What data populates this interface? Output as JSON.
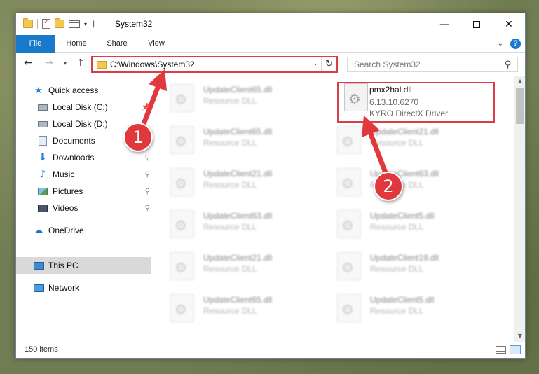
{
  "window": {
    "title": "System32",
    "controls": {
      "minimize": "—",
      "maximize": "",
      "close": "✕"
    }
  },
  "ribbon": {
    "tabs": [
      "File",
      "Home",
      "Share",
      "View"
    ],
    "help": "?"
  },
  "navigation": {
    "address": "C:\\Windows\\System32",
    "search_placeholder": "Search System32"
  },
  "sidebar": {
    "items": [
      {
        "label": "Quick access",
        "icon": "star-icon"
      },
      {
        "label": "Local Disk (C:)",
        "icon": "drive-icon"
      },
      {
        "label": "Local Disk (D:)",
        "icon": "drive-icon"
      },
      {
        "label": "Documents",
        "icon": "documents-icon"
      },
      {
        "label": "Downloads",
        "icon": "downloads-icon"
      },
      {
        "label": "Music",
        "icon": "music-icon"
      },
      {
        "label": "Pictures",
        "icon": "pictures-icon"
      },
      {
        "label": "Videos",
        "icon": "videos-icon"
      },
      {
        "label": "OneDrive",
        "icon": "cloud-icon"
      },
      {
        "label": "This PC",
        "icon": "computer-icon"
      },
      {
        "label": "Network",
        "icon": "network-icon"
      }
    ]
  },
  "files": {
    "left_column": [
      {
        "name": "UpdateClient65.dll",
        "desc": "Resource DLL"
      },
      {
        "name": "UpdateClient65.dll",
        "desc": "Resource DLL"
      },
      {
        "name": "UpdateClient21.dll",
        "desc": "Resource DLL"
      },
      {
        "name": "UpdateClient63.dll",
        "desc": "Resource DLL"
      },
      {
        "name": "UpdateClient21.dll",
        "desc": "Resource DLL"
      },
      {
        "name": "UpdateClient65.dll",
        "desc": "Resource DLL"
      }
    ],
    "right_column": [
      {
        "name": "UpdateClient21.dll",
        "desc": "Resource DLL"
      },
      {
        "name": "UpdateClient63.dll",
        "desc": "Resource DLL"
      },
      {
        "name": "UpdateClient5.dll",
        "desc": "Resource DLL"
      },
      {
        "name": "UpdateClient19.dll",
        "desc": "Resource DLL"
      },
      {
        "name": "UpdateClient5.dll",
        "desc": "Resource DLL"
      }
    ],
    "highlighted": {
      "name": "pmx2hal.dll",
      "version": "6.13.10.6270",
      "description": "KYRO DirectX Driver"
    }
  },
  "status": {
    "item_count": "150 items"
  },
  "callouts": [
    "1",
    "2"
  ],
  "colors": {
    "accent": "#1979ca",
    "highlight_red": "#d93e48",
    "badge_red": "#e0383d"
  }
}
